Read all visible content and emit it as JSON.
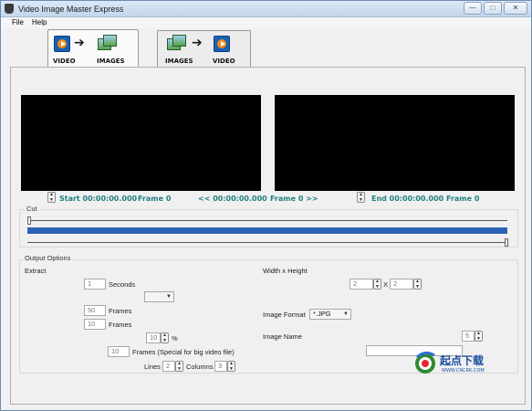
{
  "window": {
    "title": "Video Image Master Express",
    "min": "—",
    "max": "□",
    "close": "✕"
  },
  "menu": [
    "File",
    "Help"
  ],
  "tabs": [
    {
      "left": "VIDEO",
      "right": "IMAGES"
    },
    {
      "left": "IMAGES",
      "right": "VIDEO"
    }
  ],
  "timeline": {
    "start": "Start 00:00:00.000",
    "start_frame": "Frame 0",
    "middle": "<< 00:00:00.000",
    "middle_frame": "Frame 0 >>",
    "end": "End 00:00:00.000",
    "end_frame": "Frame 0"
  },
  "cut": {
    "label": "Cut"
  },
  "output": {
    "group_label": "Output Options",
    "extract_label": "Extract",
    "seconds_value": "1",
    "seconds_label": "Seconds",
    "frames1_value": "50",
    "frames1_label": "Frames",
    "frames2_value": "10",
    "frames2_label": "Frames",
    "percent_value": "10",
    "percent_label": "%",
    "special_value": "10",
    "special_label": "Frames (Special for big video file)",
    "lines_label": "Lines",
    "lines_value": "2",
    "columns_label": "Columns",
    "columns_value": "3",
    "wh_label": "Width x Height",
    "width_value": "2",
    "x_label": "X",
    "height_value": "2",
    "format_label": "Image Format",
    "format_value": "*.JPG",
    "name_label": "Image Name",
    "name_count": "5",
    "name_value": ""
  },
  "watermark": {
    "text": "起点下载",
    "sub": "WWW.CNCRK.COM"
  },
  "colors": {
    "accent": "#1f7f80",
    "cut_bar": "#2d63b6",
    "screen": "#000000"
  }
}
